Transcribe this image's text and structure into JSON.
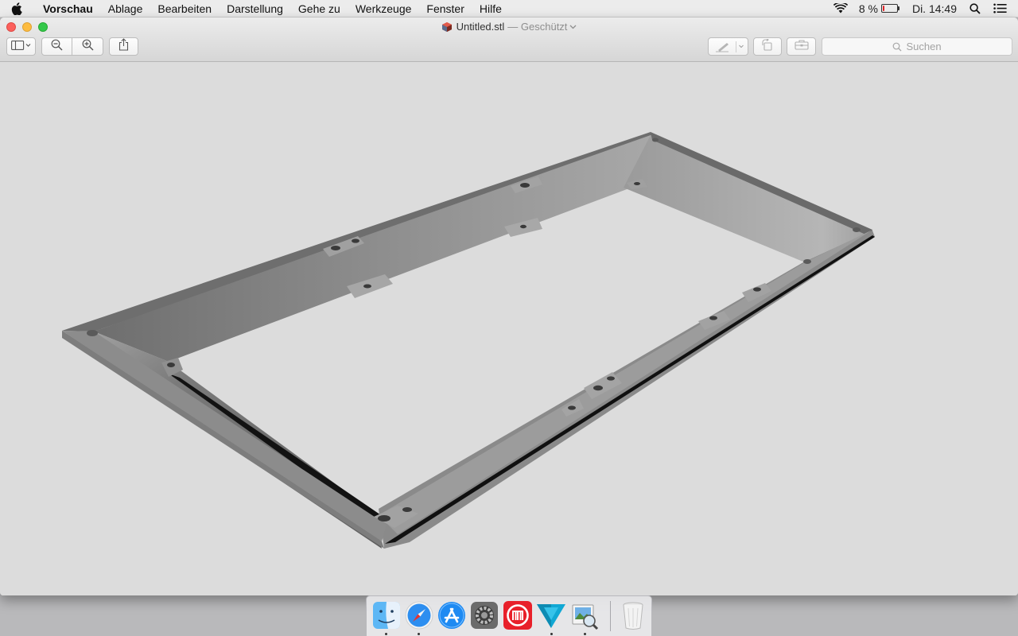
{
  "menubar": {
    "app_name": "Vorschau",
    "items": [
      "Ablage",
      "Bearbeiten",
      "Darstellung",
      "Gehe zu",
      "Werkzeuge",
      "Fenster",
      "Hilfe"
    ],
    "battery_percent_label": "8 %",
    "battery_level": 0.08,
    "battery_color": "#e2262a",
    "clock": "Di. 14:49",
    "icons": [
      "apple-icon",
      "wifi-icon",
      "battery-icon",
      "spotlight-icon",
      "notification-center-icon"
    ]
  },
  "window": {
    "title": "Untitled.stl",
    "status": "— Geschützt",
    "toolbar": {
      "buttons": [
        "sidebar-view-icon",
        "zoom-out-icon",
        "zoom-in-icon",
        "share-icon",
        "markup-pen-icon",
        "rotate-icon",
        "toolbox-icon"
      ],
      "search_placeholder": "Suchen"
    }
  },
  "viewer": {
    "content": "3D rendering of STL model: gray rectangular frame with mounting tabs and holes",
    "model_color": "#8c8c8c",
    "background_color": "#dcdcdc"
  },
  "dock": {
    "apps": [
      {
        "name": "Finder",
        "icon": "finder-icon",
        "running": true
      },
      {
        "name": "Safari",
        "icon": "safari-icon",
        "running": true
      },
      {
        "name": "App Store",
        "icon": "app-store-icon",
        "running": false
      },
      {
        "name": "Systemeinstellungen",
        "icon": "system-preferences-icon",
        "running": false
      },
      {
        "name": "MakerBot",
        "icon": "makerbot-icon",
        "running": false
      },
      {
        "name": "Cura",
        "icon": "cura-icon",
        "running": true
      },
      {
        "name": "Vorschau",
        "icon": "preview-icon",
        "running": true
      },
      {
        "name": "Papierkorb",
        "icon": "trash-icon",
        "running": false
      }
    ]
  }
}
